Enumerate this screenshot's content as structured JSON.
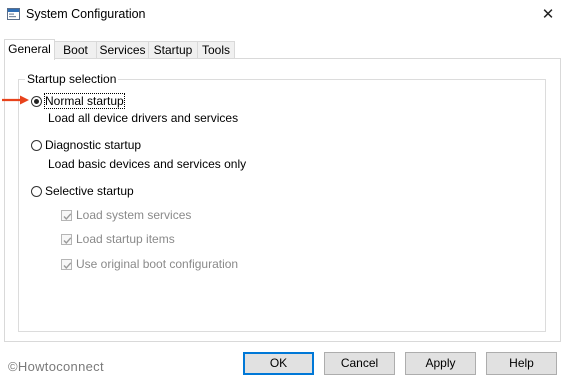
{
  "window": {
    "title": "System Configuration",
    "close_glyph": "✕",
    "app_icon": "msconfig-icon"
  },
  "tabs": [
    {
      "label": "General",
      "active": true
    },
    {
      "label": "Boot",
      "active": false
    },
    {
      "label": "Services",
      "active": false
    },
    {
      "label": "Startup",
      "active": false
    },
    {
      "label": "Tools",
      "active": false
    }
  ],
  "startup_selection": {
    "group_title": "Startup selection",
    "normal": {
      "label": "Normal startup",
      "description": "Load all device drivers and services",
      "selected": true
    },
    "diagnostic": {
      "label": "Diagnostic startup",
      "description": "Load basic devices and services only",
      "selected": false
    },
    "selective": {
      "label": "Selective startup",
      "selected": false,
      "options": [
        {
          "label": "Load system services",
          "checked": true,
          "enabled": false
        },
        {
          "label": "Load startup items",
          "checked": true,
          "enabled": false
        },
        {
          "label": "Use original boot configuration",
          "checked": true,
          "enabled": false
        }
      ]
    }
  },
  "annotation": {
    "arrow_color": "#e8431c"
  },
  "watermark": "©Howtoconnect",
  "buttons": {
    "ok": "OK",
    "cancel": "Cancel",
    "apply": "Apply",
    "help": "Help"
  },
  "colors": {
    "accent": "#0078d7",
    "disabled_text": "#8a8a8a"
  }
}
